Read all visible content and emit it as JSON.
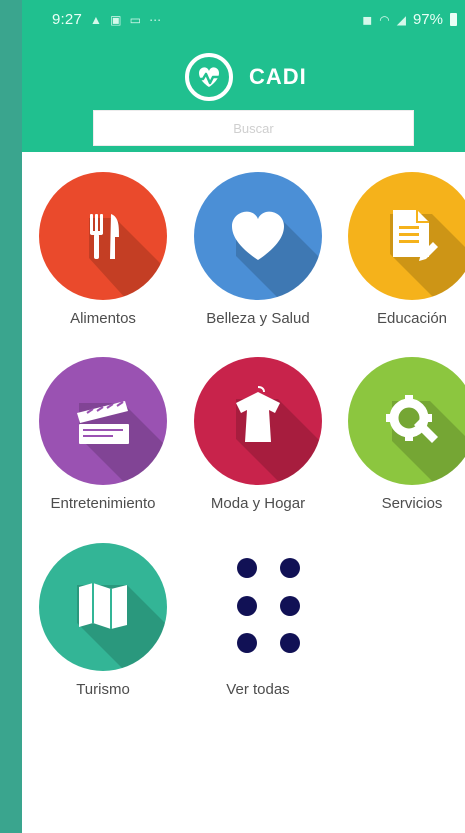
{
  "status_bar": {
    "time": "9:27",
    "battery": "97%"
  },
  "header": {
    "app_name": "CADI",
    "search_placeholder": "Buscar"
  },
  "categories": [
    {
      "label": "Alimentos",
      "color": "#ea4a2c",
      "icon": "utensils-icon"
    },
    {
      "label": "Belleza y Salud",
      "color": "#4b8fd6",
      "icon": "heart-icon"
    },
    {
      "label": "Educación",
      "color": "#f5b21b",
      "icon": "document-icon"
    },
    {
      "label": "Entretenimiento",
      "color": "#9a52b2",
      "icon": "clapperboard-icon"
    },
    {
      "label": "Moda y Hogar",
      "color": "#c8234b",
      "icon": "shirt-icon"
    },
    {
      "label": "Servicios",
      "color": "#8cc63f",
      "icon": "gear-wrench-icon"
    },
    {
      "label": "Turismo",
      "color": "#33b596",
      "icon": "map-icon"
    },
    {
      "label": "Ver todas",
      "color": "#111155",
      "icon": "grid-dots-icon"
    }
  ]
}
